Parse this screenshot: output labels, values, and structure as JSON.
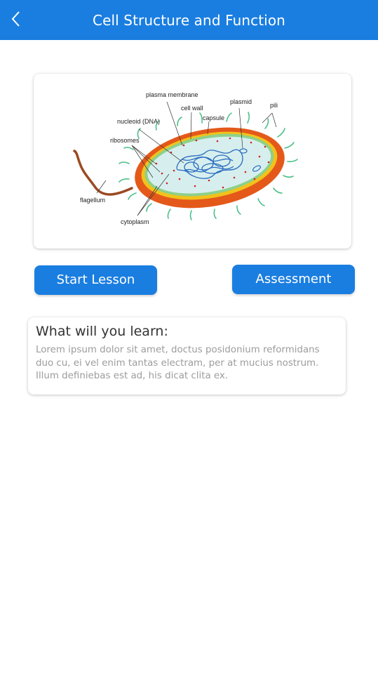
{
  "header": {
    "title": "Cell Structure and Function",
    "background": "#1a7ee0"
  },
  "diagram": {
    "labels": {
      "plasma_membrane": "plasma membrane",
      "cell_wall": "cell wall",
      "plasmid": "plasmid",
      "pili": "pili",
      "nucleoid": "nucleoid (DNA)",
      "capsule": "capsule",
      "ribosomes": "ribosomes",
      "flagellum": "flagellum",
      "cytoplasm": "cytoplasm"
    },
    "colors": {
      "capsule": "#e4591a",
      "cell_wall": "#f2c21b",
      "cytoplasm": "#d6efee",
      "dna": "#2a6bc0",
      "pili": "#4cc08a",
      "ribosomes": "#d22222",
      "flagellum": "#9b4a22"
    }
  },
  "actions": {
    "start_lesson": "Start Lesson",
    "assessment": "Assessment"
  },
  "learn": {
    "title": "What will you learn:",
    "body": "Lorem ipsum dolor sit amet, doctus posidonium reformidans duo cu, ei vel enim tantas electram, per at mucius nostrum. Illum definiebas est ad, his dicat clita ex."
  }
}
